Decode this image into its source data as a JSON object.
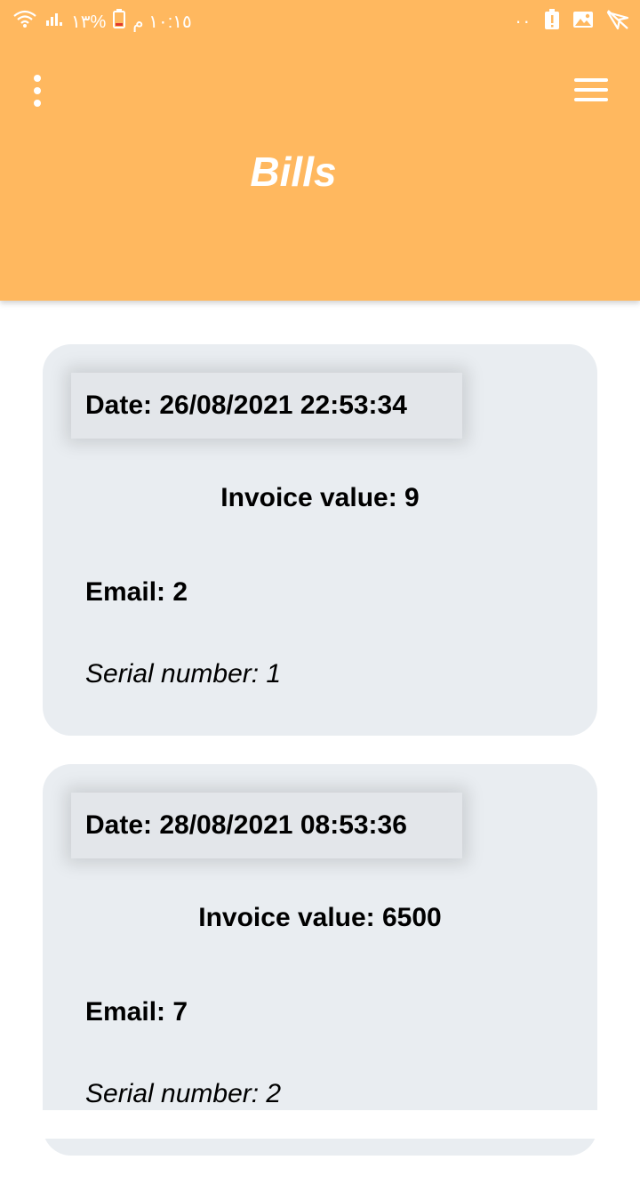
{
  "status_bar": {
    "time": "١٠:١٥ م",
    "battery_percent": "%١٣",
    "dots": "··"
  },
  "header": {
    "title": "Bills"
  },
  "bills": [
    {
      "date": "Date: 26/08/2021 22:53:34",
      "invoice_value": "Invoice value: 9",
      "email": "Email: 2",
      "serial": "Serial number: 1"
    },
    {
      "date": "Date: 28/08/2021 08:53:36",
      "invoice_value": "Invoice value: 6500",
      "email": "Email: 7",
      "serial": "Serial number: 2"
    }
  ],
  "colors": {
    "header": "#ffb85f",
    "card": "#e9edf1"
  }
}
